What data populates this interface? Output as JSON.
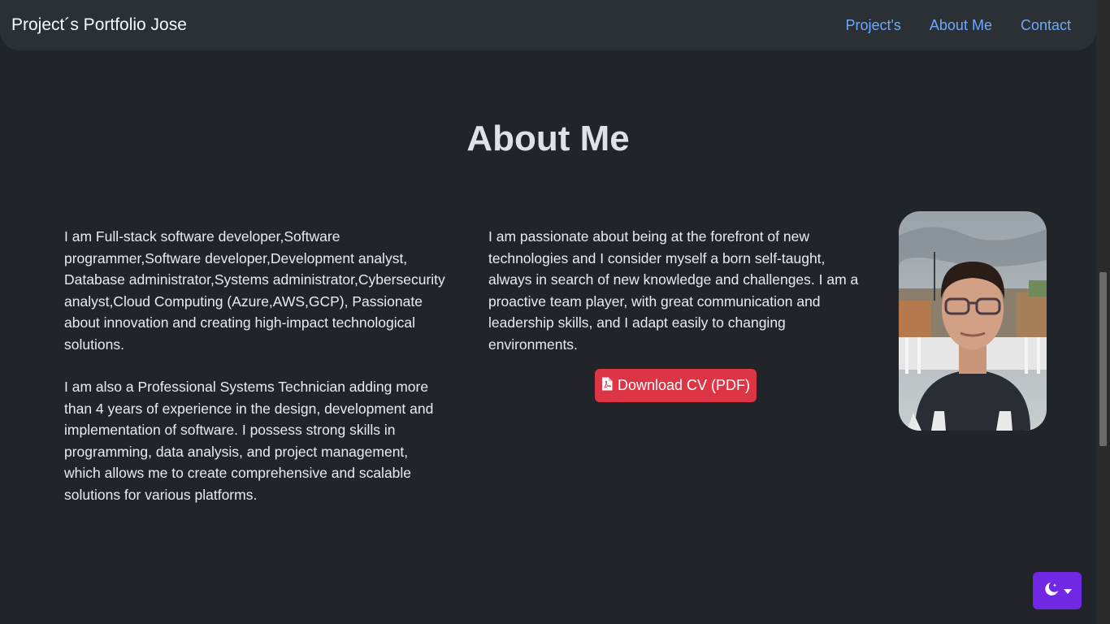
{
  "nav": {
    "brand": "Project´s Portfolio Jose",
    "links": [
      "Project's",
      "About Me",
      "Contact"
    ]
  },
  "about": {
    "title": "About Me",
    "col1": [
      "I am Full-stack software developer,Software programmer,Software developer,Development analyst, Database administrator,Systems administrator,Cybersecurity analyst,Cloud Computing (Azure,AWS,GCP), Passionate about innovation and creating high-impact technological solutions.",
      "I am also a Professional Systems Technician adding more than 4 years of experience in the design, development and implementation of software. I possess strong skills in programming, data analysis, and project management, which allows me to create comprehensive and scalable solutions for various platforms."
    ],
    "col2": "I am passionate about being at the forefront of new technologies and I consider myself a born self-taught, always in search of new knowledge and challenges. I am a proactive team player, with great communication and leadership skills, and I adapt easily to changing environments.",
    "cv_button": "Download CV (PDF)",
    "cv_icon": "file-pdf-icon"
  },
  "theme_toggle": {
    "icon": "moon-stars-icon",
    "caret": "caret-down-icon"
  },
  "colors": {
    "background": "#212529",
    "navbar": "#2b3035",
    "link": "#6ea8fe",
    "cv_button": "#dc3545",
    "theme_button": "#7028e4"
  }
}
